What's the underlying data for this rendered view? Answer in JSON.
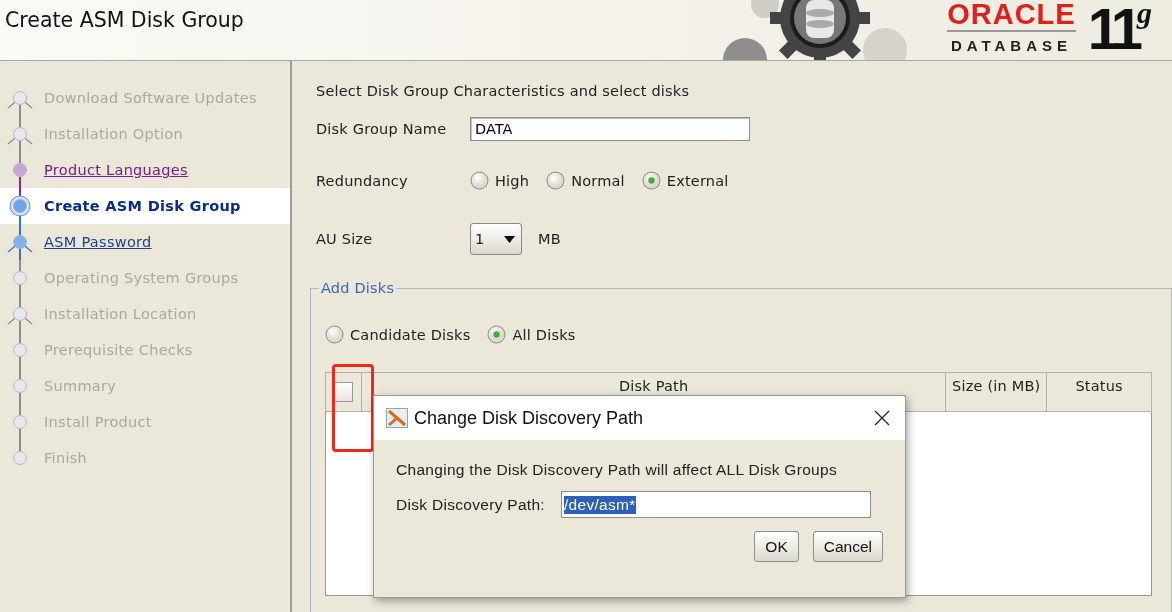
{
  "window": {
    "title": "Create ASM Disk Group"
  },
  "logo": {
    "brand": "ORACLE",
    "product": "DATABASE",
    "version": "11",
    "version_suffix": "g"
  },
  "steps": [
    {
      "label": "Download Software Updates",
      "kind": "done",
      "branch": true,
      "selected": false
    },
    {
      "label": "Installation Option",
      "kind": "done",
      "branch": true,
      "selected": false
    },
    {
      "label": "Product Languages",
      "kind": "visited",
      "branch": false,
      "selected": false
    },
    {
      "label": "Create ASM Disk Group",
      "kind": "current",
      "branch": false,
      "selected": true
    },
    {
      "label": "ASM Password",
      "kind": "link",
      "branch": true,
      "selected": false
    },
    {
      "label": "Operating System Groups",
      "kind": "pending",
      "branch": false,
      "selected": false
    },
    {
      "label": "Installation Location",
      "kind": "pending",
      "branch": true,
      "selected": false
    },
    {
      "label": "Prerequisite Checks",
      "kind": "pending",
      "branch": false,
      "selected": false
    },
    {
      "label": "Summary",
      "kind": "pending",
      "branch": false,
      "selected": false
    },
    {
      "label": "Install Product",
      "kind": "pending",
      "branch": false,
      "selected": false
    },
    {
      "label": "Finish",
      "kind": "pending",
      "branch": false,
      "selected": false
    }
  ],
  "form": {
    "intro": "Select Disk Group Characteristics and select disks",
    "disk_group_name": {
      "label": "Disk Group Name",
      "value": "DATA"
    },
    "redundancy": {
      "label": "Redundancy",
      "options": [
        {
          "label": "High",
          "selected": false
        },
        {
          "label": "Normal",
          "selected": false
        },
        {
          "label": "External",
          "selected": true
        }
      ]
    },
    "au_size": {
      "label": "AU Size",
      "value": "1",
      "unit": "MB"
    },
    "add_disks": {
      "title": "Add Disks",
      "filter": [
        {
          "label": "Candidate Disks",
          "selected": false
        },
        {
          "label": "All Disks",
          "selected": true
        }
      ],
      "table": {
        "select_all_checked": false,
        "highlighted": true,
        "columns": [
          "Disk Path",
          "Size (in MB)",
          "Status"
        ]
      }
    }
  },
  "dialog": {
    "title": "Change Disk Discovery Path",
    "message": "Changing the Disk Discovery Path will affect ALL Disk Groups",
    "field": {
      "label": "Disk Discovery Path:",
      "value": "/dev/asm*",
      "text_selected": true
    },
    "buttons": [
      {
        "label": "OK"
      },
      {
        "label": "Cancel"
      }
    ]
  }
}
